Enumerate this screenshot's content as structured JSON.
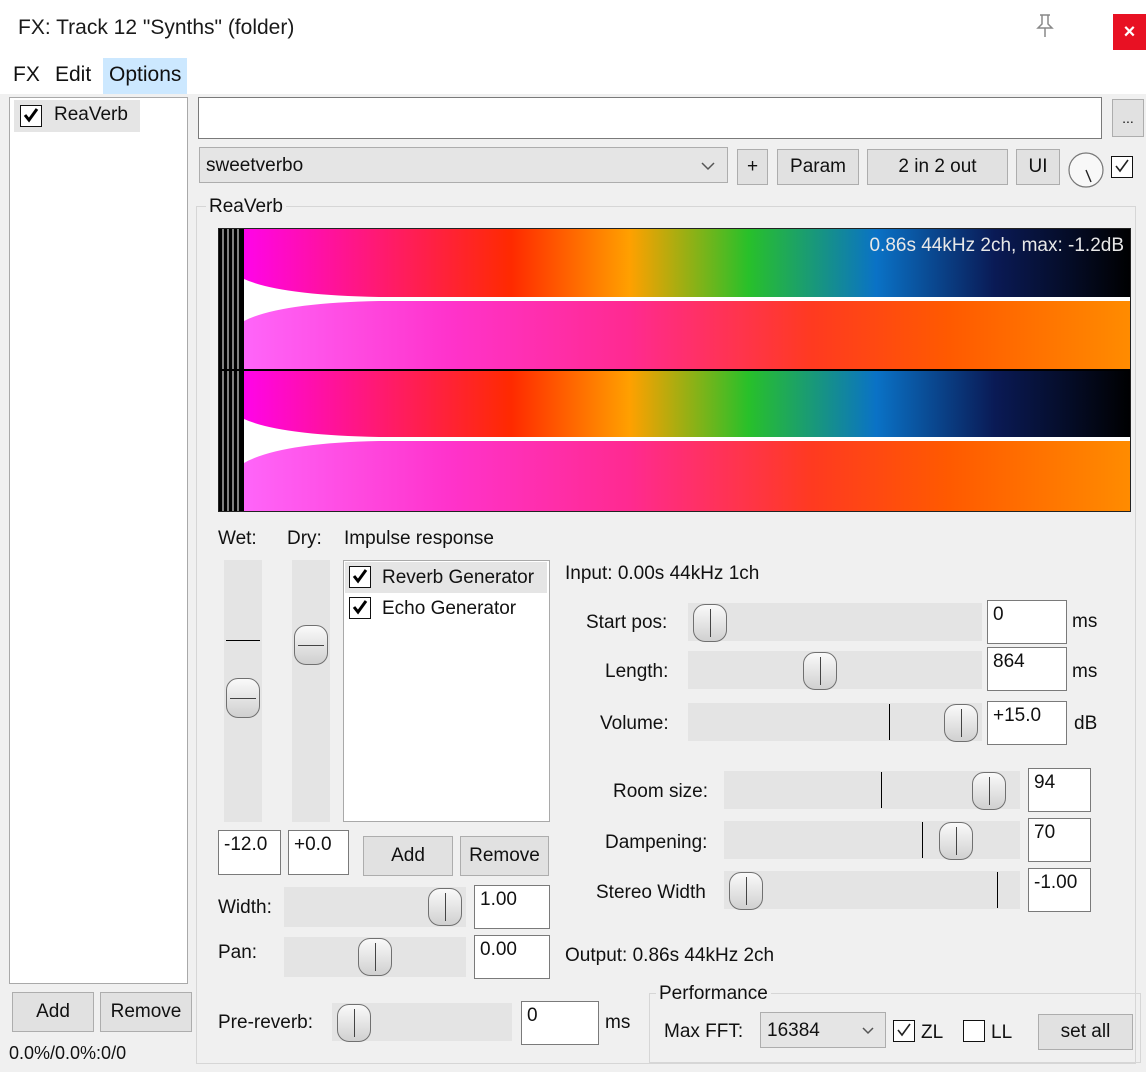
{
  "window": {
    "title": "FX: Track 12 \"Synths\" (folder)",
    "close_glyph": "×"
  },
  "menu": [
    "FX",
    "Edit",
    "Options"
  ],
  "fx_chain": {
    "items": [
      {
        "name": "ReaVerb",
        "enabled": true
      }
    ],
    "add_label": "Add",
    "remove_label": "Remove",
    "cpu_status": "0.0%/0.0%:0/0"
  },
  "top": {
    "preset_name": "sweetverbo",
    "more_label": "...",
    "plus_label": "+",
    "param_label": "Param",
    "io_label": "2 in 2 out",
    "ui_label": "UI"
  },
  "plugin": {
    "name": "ReaVerb",
    "ir_info": "0.86s 44kHz 2ch, max: -1.2dB",
    "wet_label": "Wet:",
    "dry_label": "Dry:",
    "wet_value": "-12.0",
    "dry_value": "+0.0",
    "impulse_label": "Impulse response",
    "generators": [
      {
        "name": "Reverb Generator",
        "checked": true
      },
      {
        "name": "Echo Generator",
        "checked": true
      }
    ],
    "add_label": "Add",
    "remove_label": "Remove",
    "input_info": "Input: 0.00s 44kHz 1ch",
    "output_info": "Output: 0.86s 44kHz 2ch",
    "params": {
      "start_pos": {
        "label": "Start pos:",
        "value": "0",
        "unit": "ms"
      },
      "length": {
        "label": "Length:",
        "value": "864",
        "unit": "ms"
      },
      "volume": {
        "label": "Volume:",
        "value": "+15.0",
        "unit": "dB"
      },
      "room_size": {
        "label": "Room size:",
        "value": "94"
      },
      "dampening": {
        "label": "Dampening:",
        "value": "70"
      },
      "stereo_width": {
        "label": "Stereo Width",
        "value": "-1.00"
      },
      "width": {
        "label": "Width:",
        "value": "1.00"
      },
      "pan": {
        "label": "Pan:",
        "value": "0.00"
      },
      "pre_reverb": {
        "label": "Pre-reverb:",
        "value": "0",
        "unit": "ms"
      }
    },
    "performance": {
      "label": "Performance",
      "max_fft_label": "Max FFT:",
      "max_fft_value": "16384",
      "zl_label": "ZL",
      "zl_checked": true,
      "ll_label": "LL",
      "ll_checked": false,
      "set_all_label": "set all"
    }
  },
  "colors": {
    "accent_menu": "#cce8ff",
    "close": "#e81123",
    "spectro": [
      "#ff00ff",
      "#ff2a2a",
      "#ff8c00",
      "#2ecc2e",
      "#0a6cc0",
      "#000000"
    ]
  }
}
